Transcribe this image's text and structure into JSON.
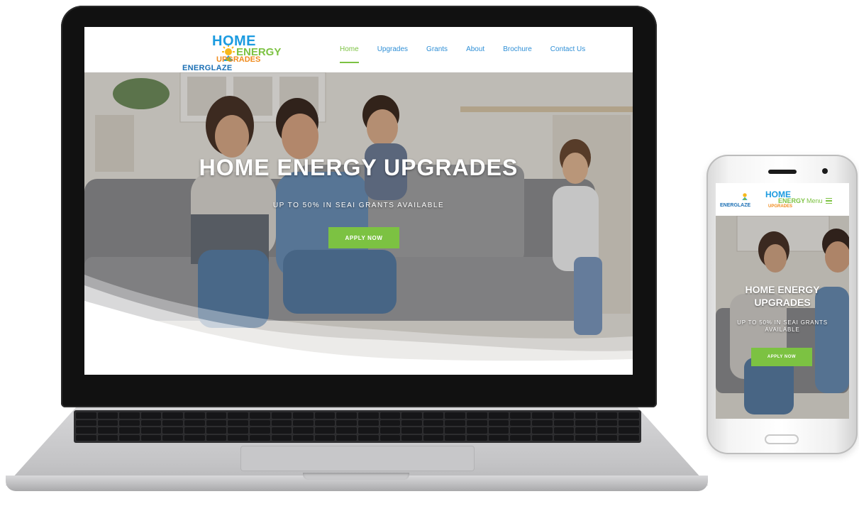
{
  "brand": {
    "company": "ENERGLAZE",
    "product_line1": "HOME",
    "product_line2": "ENERGY",
    "product_line3": "UPGRADES"
  },
  "nav": {
    "items": [
      {
        "label": "Home",
        "active": true
      },
      {
        "label": "Upgrades",
        "active": false
      },
      {
        "label": "Grants",
        "active": false
      },
      {
        "label": "About",
        "active": false
      },
      {
        "label": "Brochure",
        "active": false
      },
      {
        "label": "Contact Us",
        "active": false
      }
    ]
  },
  "hero": {
    "title": "HOME ENERGY UPGRADES",
    "subtitle": "UP TO 50% IN SEAI GRANTS AVAILABLE",
    "cta_label": "APPLY NOW"
  },
  "mobile": {
    "menu_label": "Menu",
    "title": "HOME ENERGY UPGRADES",
    "subtitle": "UP TO 50% IN SEAI GRANTS AVAILABLE",
    "cta_label": "APPLY NOW"
  },
  "colors": {
    "accent_green": "#7cc242",
    "brand_blue": "#1c9be0",
    "brand_orange": "#f08b1d",
    "nav_blue": "#2f8fd6"
  },
  "icons": {
    "logo_sun": "sun-house-icon",
    "menu": "hamburger-icon"
  }
}
